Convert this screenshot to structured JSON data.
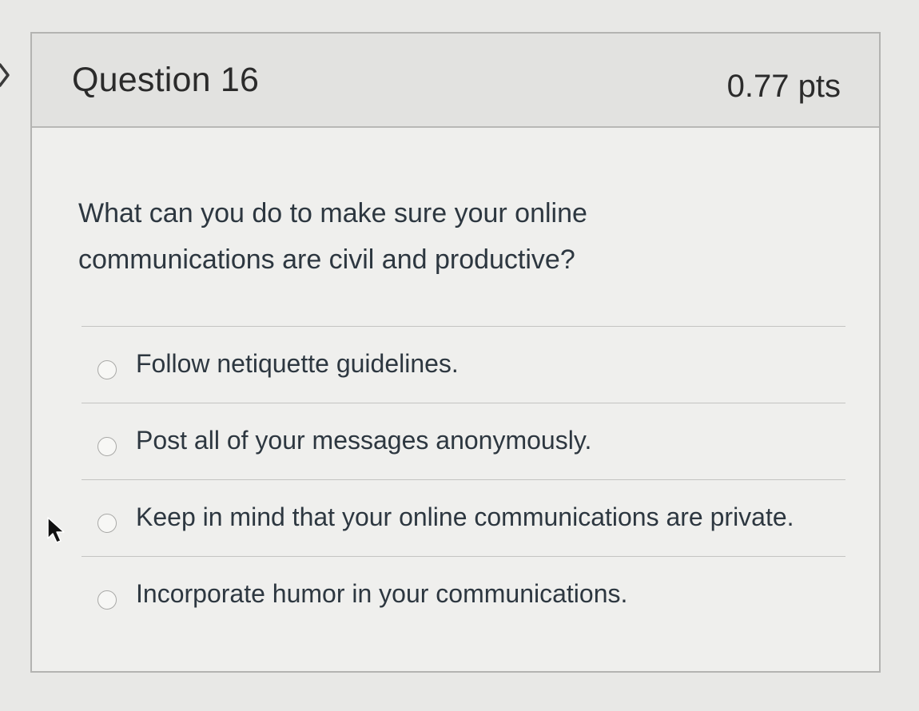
{
  "question": {
    "title": "Question 16",
    "points": "0.77 pts",
    "text": "What can you do to make sure your online communications are civil and productive?"
  },
  "answers": [
    {
      "label": "Follow netiquette guidelines.",
      "selected": false
    },
    {
      "label": "Post all of your messages anonymously.",
      "selected": false
    },
    {
      "label": "Keep in mind that your online communications are private.",
      "selected": false
    },
    {
      "label": "Incorporate humor in your communications.",
      "selected": false
    }
  ],
  "icons": {
    "left_edge": "chevron-right-icon",
    "pointer": "mouse-cursor-icon"
  },
  "colors": {
    "header_background": "#e2e2e0",
    "card_background": "#efefed",
    "text": "#2d3740"
  }
}
